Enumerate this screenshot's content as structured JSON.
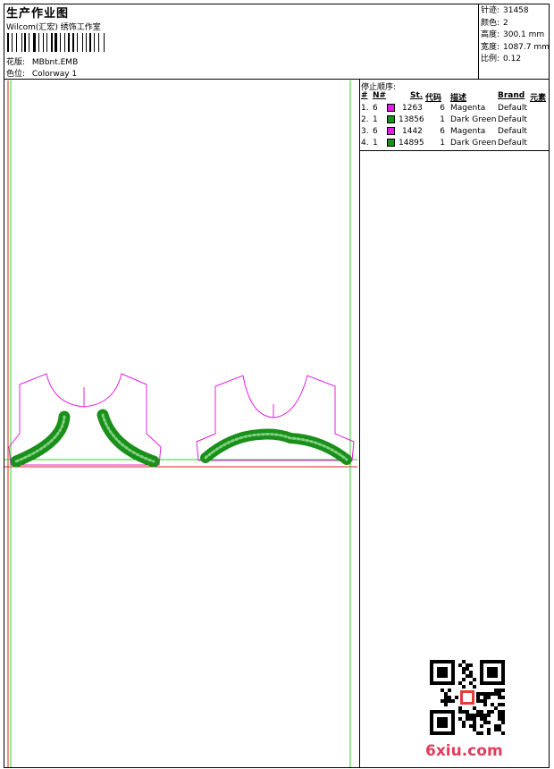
{
  "header": {
    "title": "生产作业图",
    "subtitle": "Wilcom(汇宏) 绣饰工作室",
    "design_label": "花版:",
    "design_value": "MBbnt.EMB",
    "colorway_label": "色位:",
    "colorway_value": "Colorway 1"
  },
  "stats": [
    {
      "label": "针迹:",
      "value": "31458"
    },
    {
      "label": "颜色:",
      "value": "2"
    },
    {
      "label": "高度:",
      "value": "300.1 mm"
    },
    {
      "label": "宽度:",
      "value": "1087.7 mm"
    },
    {
      "label": "比例:",
      "value": "0.12"
    }
  ],
  "sequence": {
    "title": "停止顺序:",
    "headers": {
      "num": "#",
      "n": "N#",
      "st": "St.",
      "code": "代码",
      "desc": "描述",
      "brand": "Brand",
      "elem": "元素"
    },
    "rows": [
      {
        "num": "1.",
        "n": "6",
        "color": "#e020e0",
        "st": "1263",
        "code": "6",
        "desc": "Magenta",
        "brand": "Default"
      },
      {
        "num": "2.",
        "n": "1",
        "color": "#1a8f1a",
        "st": "13856",
        "code": "1",
        "desc": "Dark Green",
        "brand": "Default"
      },
      {
        "num": "3.",
        "n": "6",
        "color": "#e020e0",
        "st": "1442",
        "code": "6",
        "desc": "Magenta",
        "brand": "Default"
      },
      {
        "num": "4.",
        "n": "1",
        "color": "#1a8f1a",
        "st": "14895",
        "code": "1",
        "desc": "Dark Green",
        "brand": "Default"
      }
    ]
  },
  "colors": {
    "magenta": "#e020e0",
    "green": "#1a8f1a",
    "guide_green": "#2bd22b",
    "guide_red": "#e02020",
    "logo": "#e23b5c"
  },
  "watermark": {
    "text": "6xiu.com"
  }
}
